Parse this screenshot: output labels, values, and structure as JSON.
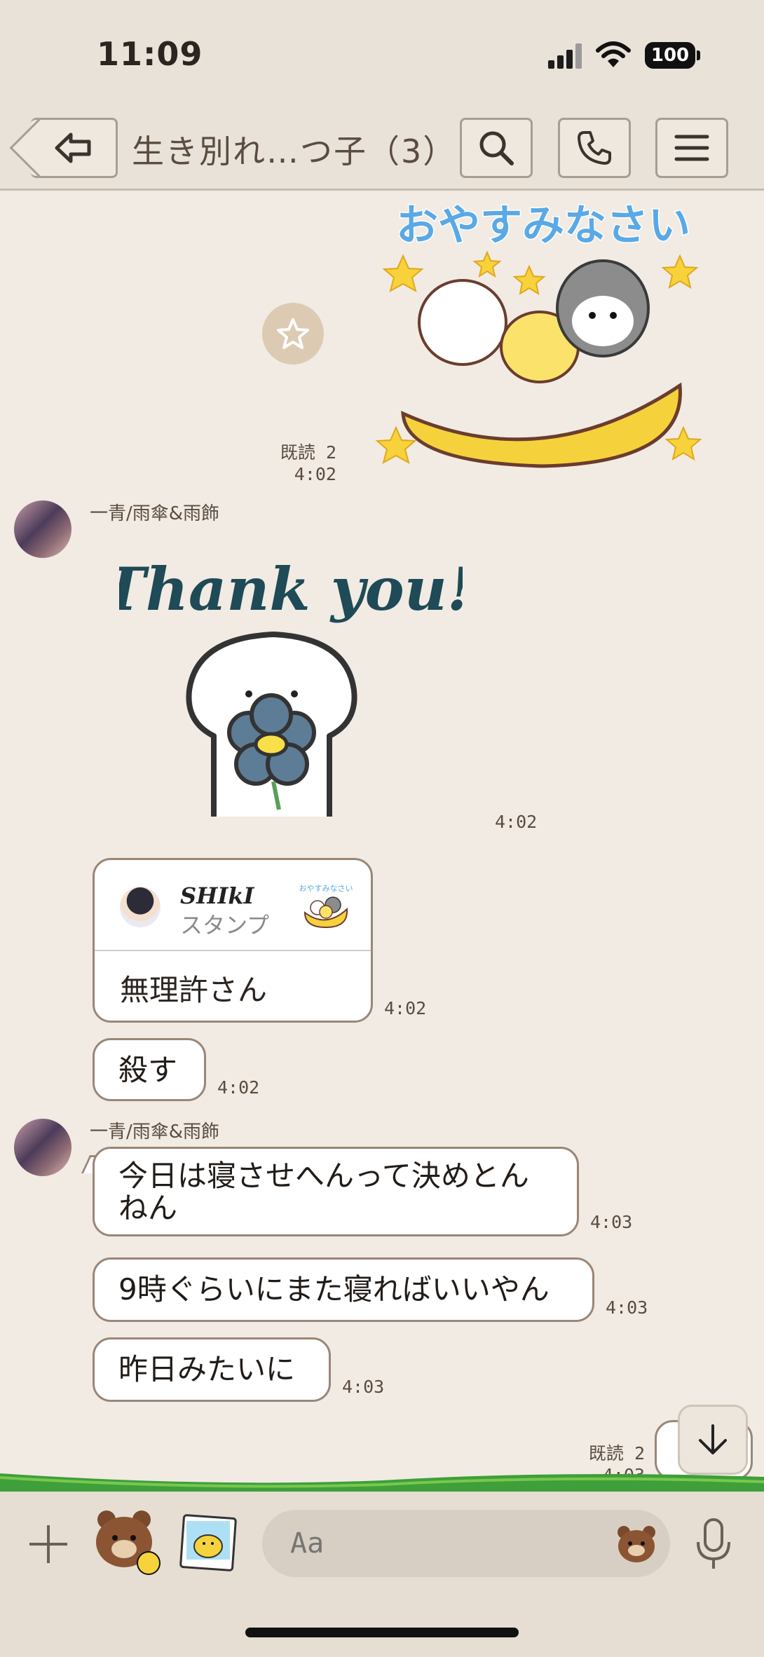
{
  "status": {
    "time": "11:09",
    "battery": "100"
  },
  "header": {
    "title": "生き別れ…つ子（3）"
  },
  "messages": {
    "sticker1": {
      "caption": "おやすみなさい",
      "read": "既読 2",
      "time": "4:02"
    },
    "sender_name_1": "一青/雨傘&雨飾",
    "sticker2": {
      "caption": "Thank you!",
      "time": "4:02"
    },
    "share_card": {
      "name": "SHIkI",
      "subtitle": "スタンプ",
      "thumb_caption": "おやすみなさい",
      "message": "無理許さん",
      "time": "4:02"
    },
    "msg_kill": {
      "text": "殺す",
      "time": "4:02"
    },
    "sender_name_2": "一青/雨傘&雨飾",
    "msg_1": {
      "line1": "今日は寝させへんって決めとん",
      "line2": "ねん",
      "time": "4:03"
    },
    "msg_2": {
      "text": "9時ぐらいにまた寝ればいいやん",
      "time": "4:03"
    },
    "msg_3": {
      "text": "昨日みたいに",
      "time": "4:03"
    },
    "partial": {
      "read": "既読 2",
      "time": "4:03"
    }
  },
  "input": {
    "placeholder": "Aa"
  },
  "colors": {
    "background": "#f1ebe3",
    "bubble_border": "#9a8677",
    "header": "#e9e2d8",
    "grass": "#3f9f3a"
  }
}
